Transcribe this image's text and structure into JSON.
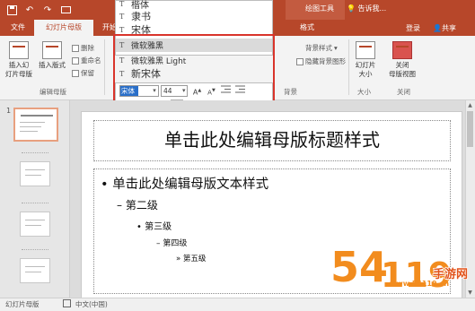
{
  "colors": {
    "accent": "#b7472a",
    "selection": "#2a6fc9",
    "annotation_red": "#d9342b",
    "watermark_orange": "#f28c1e"
  },
  "qat": {
    "icons": [
      "save-icon",
      "undo-icon",
      "redo-icon",
      "start-from-beginning-icon"
    ]
  },
  "tabs": {
    "file": "文件",
    "slide_master": "幻灯片母版",
    "home_partial": "开始",
    "format": "格式"
  },
  "context": {
    "drawing_tools": "绘图工具",
    "tell_me": "告诉我...",
    "sign_in": "登录",
    "share": "共享"
  },
  "ribbon": {
    "insert_slide_master": "插入幻\n灯片母版",
    "insert_layout": "插入版式",
    "delete": "删除",
    "rename": "重命名",
    "preserve": "保留",
    "group_edit_master": "编辑母版",
    "background_styles": "背景样式",
    "hide_background_graphics": "隐藏背景图形",
    "group_background": "背景",
    "slide_size": "幻灯片\n大小",
    "close_master_view": "关闭\n母版视图",
    "group_size": "大小",
    "group_close": "关闭"
  },
  "font_dropdown": {
    "items": [
      {
        "name": "楷体",
        "icon": "truetype-icon"
      },
      {
        "name": "隶书",
        "icon": "truetype-icon"
      },
      {
        "name": "宋体",
        "icon": "truetype-icon"
      },
      {
        "name": "微软雅黑",
        "icon": "truetype-icon",
        "highlighted": true
      },
      {
        "name": "微软雅黑 Light",
        "icon": "truetype-icon"
      },
      {
        "name": "新宋体",
        "icon": "truetype-icon"
      }
    ]
  },
  "mini_toolbar": {
    "font_value": "宋体",
    "size_value": "44",
    "grow_font": "A",
    "shrink_font": "A",
    "bold": "B",
    "italic": "I",
    "font_color": "A"
  },
  "slide": {
    "number": "1",
    "title": "单击此处编辑母版标题样式",
    "levels": [
      "• 单击此处编辑母版文本样式",
      "– 第二级",
      "• 第三级",
      "– 第四级",
      "» 第五级"
    ]
  },
  "status": {
    "view": "幻灯片母版",
    "language": "中文(中国)"
  },
  "watermark": {
    "text": "54119手游网",
    "url": "www.54119.cn"
  }
}
